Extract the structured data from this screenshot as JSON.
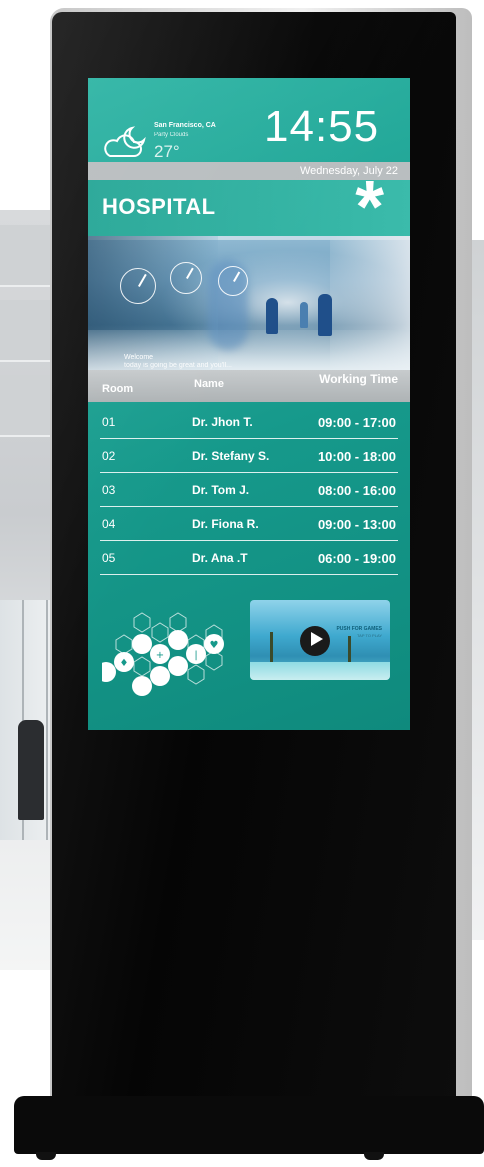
{
  "weather": {
    "city": "San Francisco, CA",
    "condition": "Party Clouds",
    "temperature": "27°"
  },
  "clock": {
    "time": "14:55",
    "date": "Wednesday, July 22"
  },
  "header": {
    "title": "HOSPITAL",
    "logo_icon": "medical-asterisk-icon"
  },
  "photo": {
    "welcome_line1": "Welcome",
    "welcome_line2": "today is going be great and you'll..."
  },
  "table": {
    "columns": [
      "Room",
      "Name",
      "Working Time"
    ],
    "rows": [
      {
        "room": "01",
        "name": "Dr. Jhon T.",
        "time": "09:00 - 17:00"
      },
      {
        "room": "02",
        "name": "Dr. Stefany S.",
        "time": "10:00 - 18:00"
      },
      {
        "room": "03",
        "name": "Dr. Tom J.",
        "time": "08:00 - 16:00"
      },
      {
        "room": "04",
        "name": "Dr. Fiona R.",
        "time": "09:00 - 13:00"
      },
      {
        "room": "05",
        "name": "Dr. Ana .T",
        "time": "06:00 - 19:00"
      }
    ]
  },
  "video": {
    "title": "PUSH FOR GAMES",
    "subtitle": "TAP TO PLAY",
    "play_icon": "play-icon"
  },
  "colors": {
    "screen_teal": "#16998b",
    "accent_teal": "#2fb5a5",
    "header_gray": "#b9bec0",
    "kiosk_black": "#0a0a0a"
  }
}
